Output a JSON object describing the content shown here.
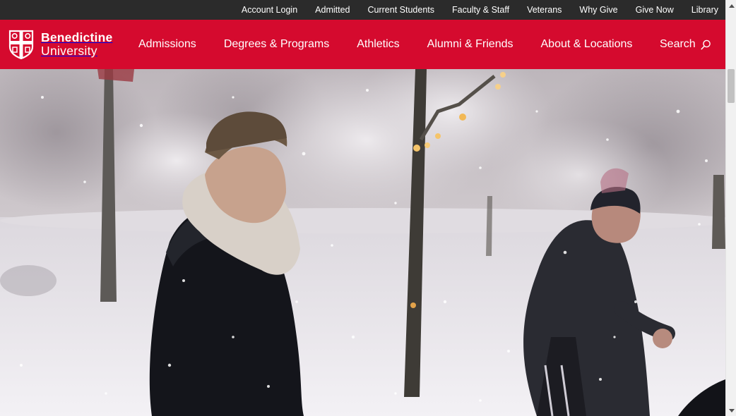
{
  "utility_nav": {
    "items": [
      "Account Login",
      "Admitted",
      "Current Students",
      "Faculty & Staff",
      "Veterans",
      "Why Give",
      "Give Now",
      "Library"
    ]
  },
  "brand": {
    "name_line1": "Benedictine",
    "name_line2": "University",
    "logo_icon": "shield-cross-icon"
  },
  "main_nav": {
    "items": [
      "Admissions",
      "Degrees & Programs",
      "Athletics",
      "Alumni & Friends",
      "About & Locations"
    ],
    "search_label": "Search",
    "search_icon": "search-icon"
  },
  "hero": {
    "image": "hero-image"
  },
  "colors": {
    "utility_bg": "#2b2b2b",
    "brand_red": "#d50a2e",
    "text_light": "#ffffff"
  }
}
